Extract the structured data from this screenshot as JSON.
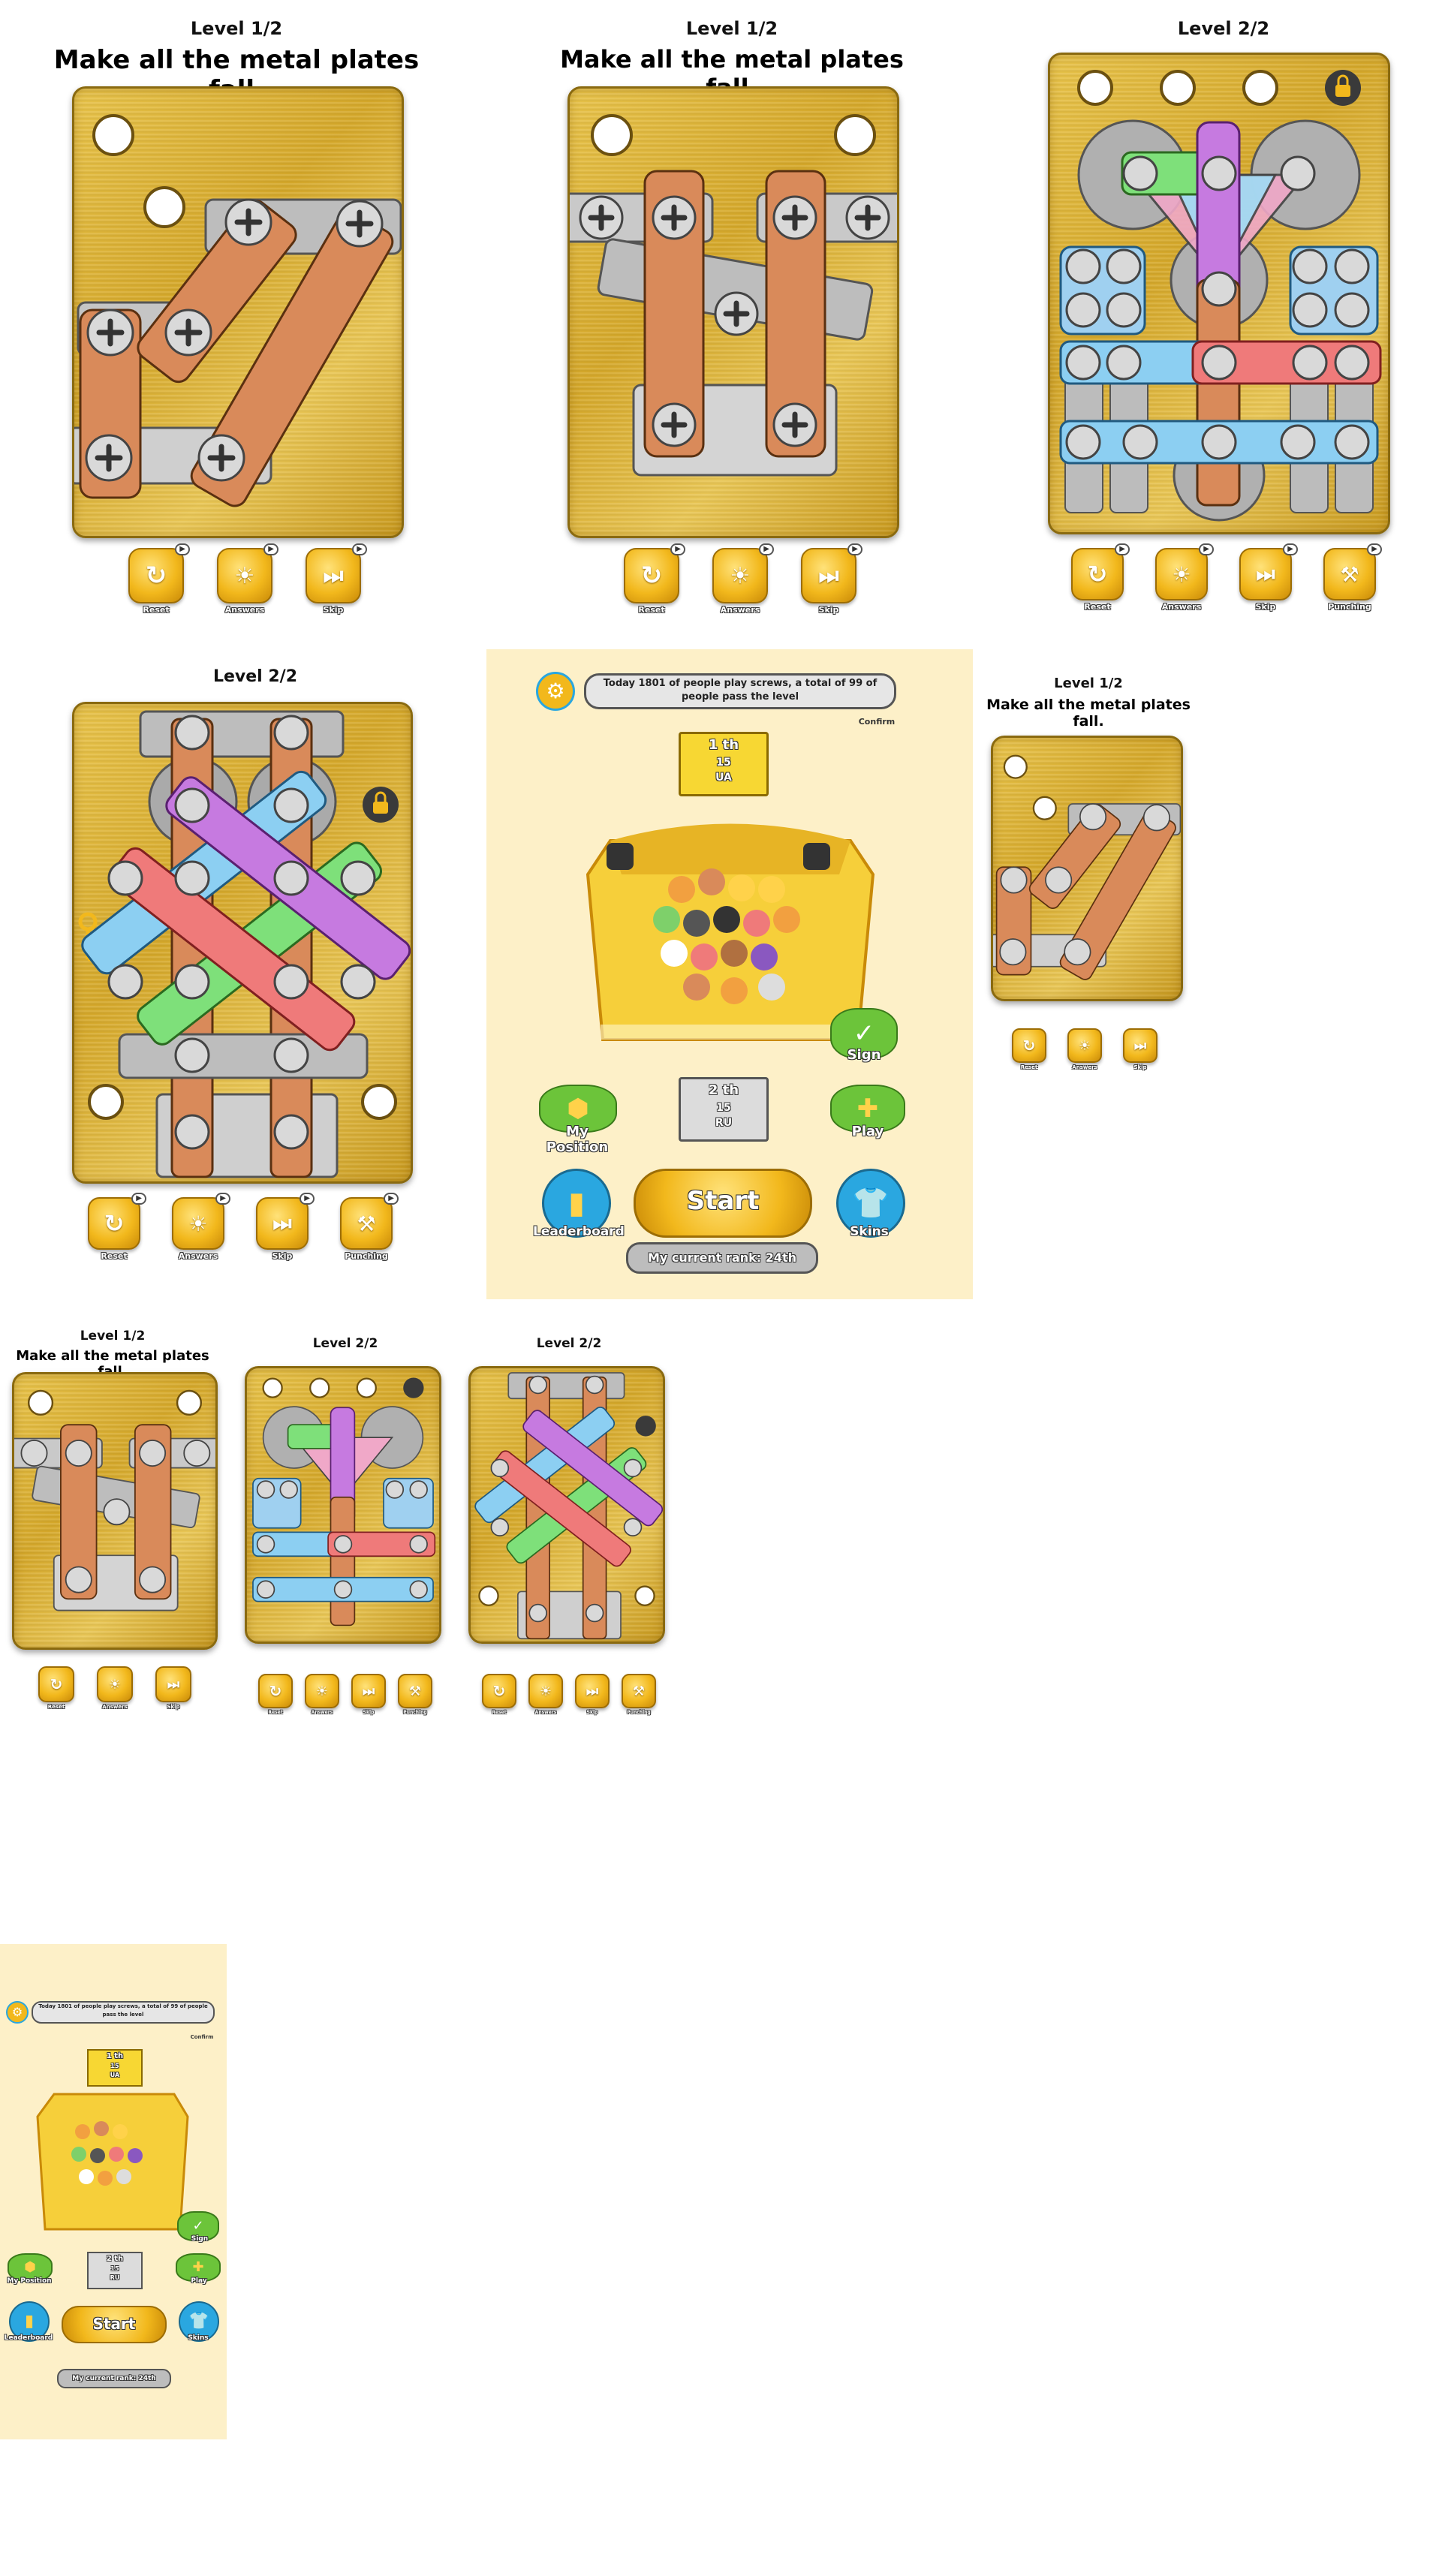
{
  "panel1": {
    "level": "Level 1/2",
    "instruction": "Make all the metal plates fall."
  },
  "panel2": {
    "level": "Level 1/2",
    "instruction": "Make all the metal plates fall."
  },
  "panel3": {
    "level": "Level 2/2"
  },
  "panel4": {
    "level": "Level 2/2"
  },
  "panel6": {
    "level": "Level 1/2",
    "instruction": "Make all the metal plates fall."
  },
  "panel7": {
    "level": "Level 1/2",
    "instruction": "Make all the metal plates fall."
  },
  "panel8": {
    "level": "Level 2/2"
  },
  "panel9": {
    "level": "Level 2/2"
  },
  "buttons": {
    "reset": "Reset",
    "answers": "Answers",
    "skip": "Skip",
    "punching": "Punching",
    "ad_badge": "▶"
  },
  "icons": {
    "reset": "reset-icon",
    "answers": "lightbulb-icon",
    "skip": "skip-icon",
    "punching": "hammer-icon",
    "lock": "lock-icon",
    "key": "key-icon",
    "gear": "gear-icon"
  },
  "lobby": {
    "banner": "Today 1801 of people play screws, a total of 99 of people pass the level",
    "confirm": "Confirm",
    "rank1": {
      "place": "1 th",
      "value": "15",
      "country": "UA"
    },
    "rank2": {
      "place": "2 th",
      "value": "15",
      "country": "RU"
    },
    "sign": "Sign",
    "my_position": "My Position",
    "play": "Play",
    "leaderboard": "Leaderboard",
    "start": "Start",
    "skins": "Skins",
    "current_rank": "My current rank: 24th"
  },
  "colors": {
    "gold": "#d9ad2f",
    "copper": "#d98a5a",
    "steel": "#b8b8b8",
    "cream": "#fdf0c8",
    "green_btn": "#6cc43a",
    "blue_btn": "#2aa7e0"
  }
}
